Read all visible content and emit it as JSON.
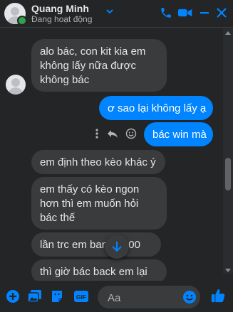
{
  "header": {
    "name": "Quang Minh",
    "status": "Đang hoạt động"
  },
  "messages": [
    {
      "side": "them",
      "text": "alo bác, con kit kia em không lấy nữa được không bác"
    },
    {
      "side": "me",
      "text": "ơ sao lại không lấy ạ"
    },
    {
      "side": "me",
      "text": "bác win mà"
    },
    {
      "side": "them",
      "text": "em định theo kèo khác ý"
    },
    {
      "side": "them",
      "text": "em thấy có kèo ngon hơn thì em muốn hỏi bác thế"
    },
    {
      "side": "them",
      "text": "lần trc em ban ... 900"
    },
    {
      "side": "them",
      "text": "thì giờ bác back em lại"
    }
  ],
  "composer": {
    "placeholder": "Aa"
  },
  "colors": {
    "accent": "#0084ff",
    "background": "#242526",
    "bubble_them": "#3a3b3c",
    "online": "#31a24c"
  }
}
